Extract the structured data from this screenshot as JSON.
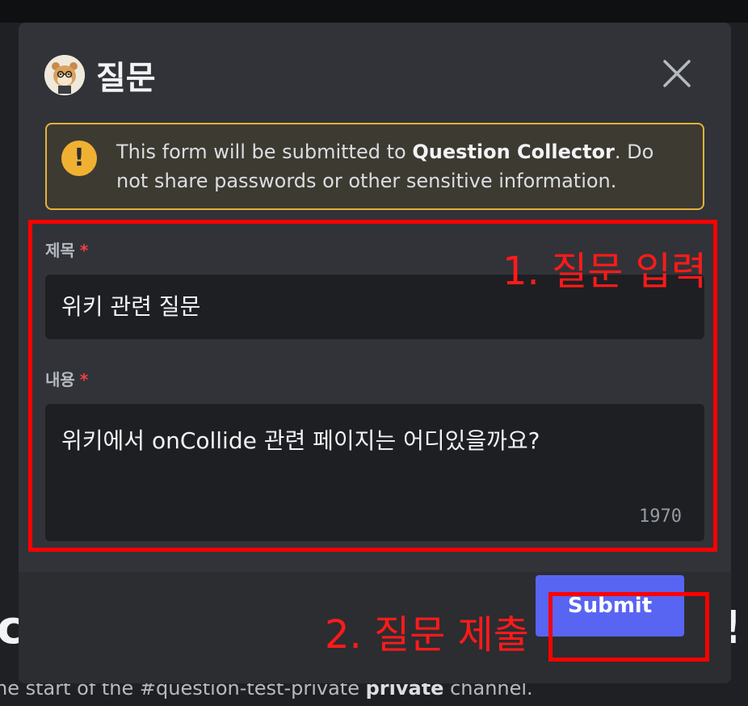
{
  "background": {
    "heading_left": "c",
    "heading_right": "!",
    "intro_start": "he start of the #question-test-private ",
    "intro_bold": "private",
    "intro_end": " channel."
  },
  "modal": {
    "title": "질문",
    "warning": {
      "pre": "This form will be submitted to ",
      "app_name": "Question Collector",
      "post": ". Do not share passwords or other sensitive information."
    },
    "fields": [
      {
        "label": "제목",
        "required_mark": "*",
        "value": "위키 관련 질문"
      },
      {
        "label": "내용",
        "required_mark": "*",
        "value": "위키에서 onCollide 관련 페이지는 어디있을까요?",
        "remaining_chars": "1970"
      }
    ],
    "submit_label": "Submit"
  },
  "annotations": {
    "step1": "1. 질문 입력",
    "step2": "2. 질문 제출",
    "color": "#ff0000"
  },
  "colors": {
    "accent": "#5865f2",
    "warning": "#f0b132",
    "modal_bg": "#313338"
  }
}
